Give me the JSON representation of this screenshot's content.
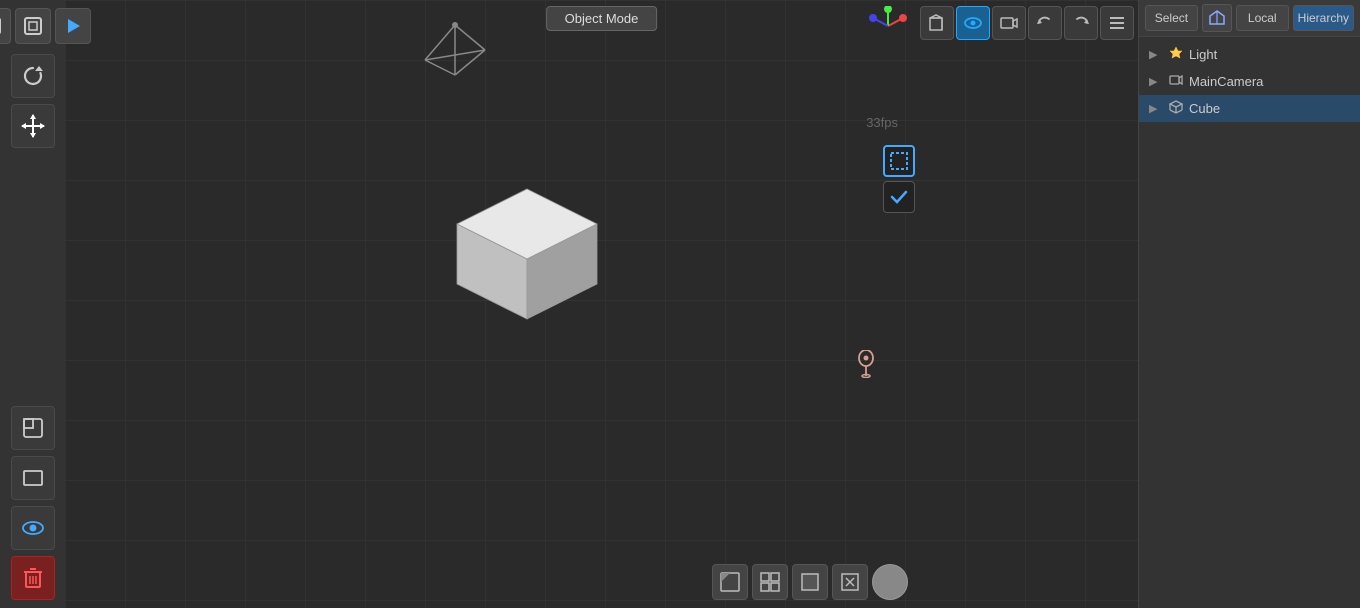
{
  "toolbar": {
    "object_mode_label": "Object Mode"
  },
  "fps": "33fps",
  "sidebar": {
    "top_icons": [
      {
        "name": "cube-icon",
        "symbol": "⬜",
        "label": "scene"
      },
      {
        "name": "box-outline-icon",
        "symbol": "▣",
        "label": "box"
      },
      {
        "name": "play-icon",
        "symbol": "▶",
        "label": "play"
      }
    ],
    "refresh_icon": "↻",
    "move_icon": "✛",
    "tools": [
      {
        "name": "layer-icon",
        "symbol": "◫",
        "label": "layer"
      },
      {
        "name": "frame-icon",
        "symbol": "▭",
        "label": "frame"
      },
      {
        "name": "eye-icon",
        "symbol": "👁",
        "label": "eye"
      },
      {
        "name": "trash-icon",
        "symbol": "🗑",
        "label": "trash",
        "style": "red"
      }
    ]
  },
  "hierarchy": {
    "title": "Hierarchy",
    "select_label": "Select",
    "local_label": "Local",
    "items": [
      {
        "id": "light",
        "label": "Light",
        "icon": "▶",
        "type": "light"
      },
      {
        "id": "main-camera",
        "label": "MainCamera",
        "icon": "▶",
        "type": "camera"
      },
      {
        "id": "cube",
        "label": "Cube",
        "icon": "▶",
        "type": "cube",
        "selected": true
      }
    ]
  },
  "viewport_gizmos": [
    {
      "name": "cube-gizmo",
      "symbol": "⬛",
      "active": false
    },
    {
      "name": "eye-gizmo",
      "symbol": "👁",
      "active": true,
      "color": "#2af"
    },
    {
      "name": "camera-gizmo",
      "symbol": "📷",
      "active": false
    },
    {
      "name": "undo-gizmo",
      "symbol": "↩",
      "active": false
    },
    {
      "name": "redo-gizmo",
      "symbol": "↪",
      "active": false
    },
    {
      "name": "menu-gizmo",
      "symbol": "☰",
      "active": false
    }
  ],
  "bottom_toolbar": [
    {
      "name": "shading-icon",
      "symbol": "◪"
    },
    {
      "name": "layout-icon",
      "symbol": "⊞"
    },
    {
      "name": "cube-bottom-icon",
      "symbol": "⬛"
    },
    {
      "name": "delete-bottom-icon",
      "symbol": "⊡"
    },
    {
      "name": "sphere-icon",
      "symbol": "●"
    }
  ],
  "colors": {
    "bg": "#2a2a2a",
    "sidebar_bg": "#333333",
    "panel_bg": "#333333",
    "accent": "#2a9af3",
    "selected": "#2a4a6a",
    "grid": "#3a3a3a",
    "cube_top": "#e0e0e0",
    "cube_left": "#c0c0c0",
    "cube_right": "#a0a0a0"
  }
}
